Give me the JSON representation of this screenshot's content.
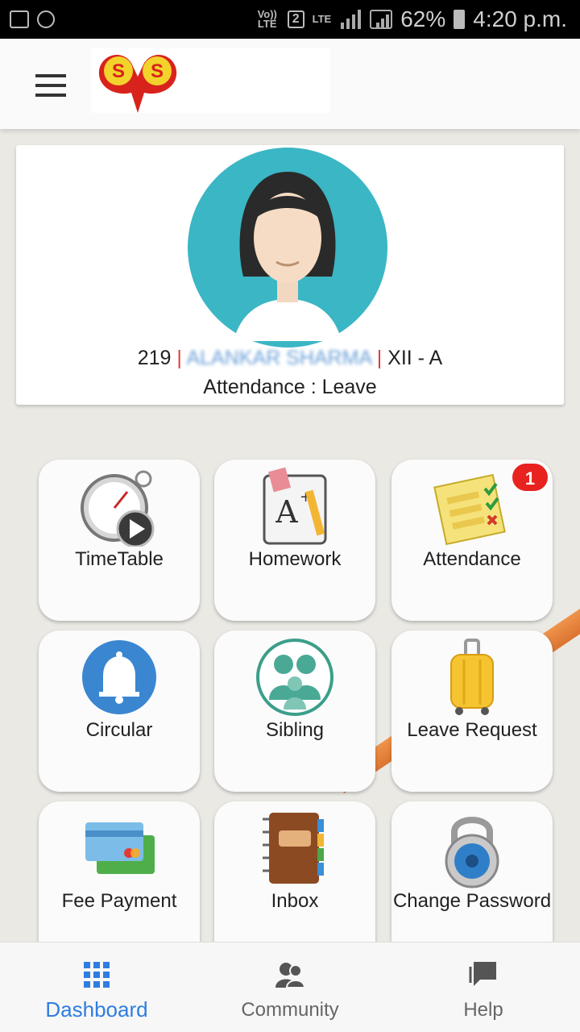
{
  "status_bar": {
    "network_label": "Vo)) LTE",
    "sim": "2",
    "lte": "LTE",
    "battery": "62%",
    "time": "4:20 p.m."
  },
  "app_bar": {
    "menu_icon": "hamburger-menu-icon",
    "logo_text": "SS"
  },
  "profile": {
    "roll": "219",
    "separator": "|",
    "name": "ALANKAR SHARMA",
    "class": "XII - A",
    "attendance": "Attendance : Leave"
  },
  "tiles": [
    {
      "label": "TimeTable",
      "icon": "stopwatch-icon"
    },
    {
      "label": "Homework",
      "icon": "notebook-pencil-icon"
    },
    {
      "label": "Attendance",
      "icon": "checklist-icon",
      "badge": "1"
    },
    {
      "label": "Circular",
      "icon": "bell-icon"
    },
    {
      "label": "Sibling",
      "icon": "family-icon"
    },
    {
      "label": "Leave Request",
      "icon": "suitcase-icon"
    },
    {
      "label": "Fee Payment",
      "icon": "credit-cards-icon"
    },
    {
      "label": "Inbox",
      "icon": "address-book-icon"
    },
    {
      "label": "Change Password",
      "icon": "padlock-icon"
    }
  ],
  "bottom_nav": [
    {
      "label": "Dashboard",
      "icon": "grid-icon",
      "active": true
    },
    {
      "label": "Community",
      "icon": "people-icon"
    },
    {
      "label": "Help",
      "icon": "chat-bubble-icon"
    }
  ],
  "colors": {
    "accent": "#2f7de1",
    "badge": "#e8231f",
    "avatar_bg": "#3bb6c4"
  }
}
